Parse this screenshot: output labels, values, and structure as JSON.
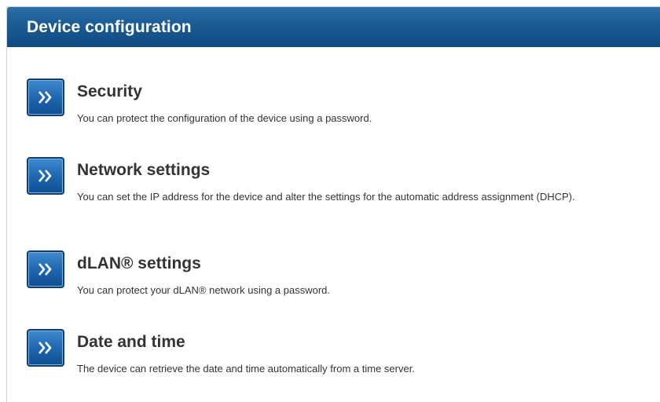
{
  "header": {
    "title": "Device configuration"
  },
  "items": [
    {
      "title": "Security",
      "description": "You can protect the configuration of the device using a password.",
      "button_icon": "double-chevron-right-icon"
    },
    {
      "title": "Network settings",
      "description": "You can set the IP address for the device and alter the settings for the automatic address assignment (DHCP).",
      "button_icon": "double-chevron-right-icon"
    },
    {
      "title": "dLAN® settings",
      "description": "You can protect your dLAN® network using a password.",
      "button_icon": "double-chevron-right-icon"
    },
    {
      "title": "Date and time",
      "description": "The device can retrieve the date and time automatically from a time server.",
      "button_icon": "double-chevron-right-icon"
    }
  ],
  "colors": {
    "header_blue": "#1b5b94",
    "button_blue": "#1f68b0",
    "text": "#333333"
  }
}
